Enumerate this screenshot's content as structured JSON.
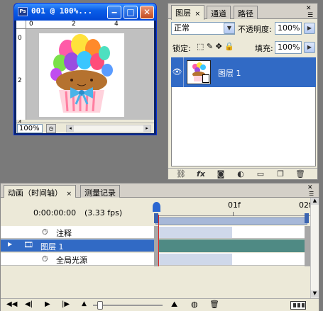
{
  "document": {
    "title": "001 @ 100%...",
    "app_badge": "Ps",
    "zoom": "100%",
    "ruler_top": [
      "0",
      "2",
      "4"
    ],
    "ruler_left": [
      "0",
      "2",
      "4"
    ]
  },
  "layers_panel": {
    "tabs": [
      "图层",
      "通道",
      "路径"
    ],
    "blend_mode": "正常",
    "opacity_label": "不透明度:",
    "opacity_value": "100%",
    "lock_label": "锁定:",
    "fill_label": "填充:",
    "fill_value": "100%",
    "layer_name": "图层 1"
  },
  "animation_panel": {
    "tabs": [
      "动画（时间轴）",
      "测量记录"
    ],
    "time": "0:00:00:00",
    "fps": "(3.33 fps)",
    "ruler_labels": [
      "01f",
      "02f"
    ],
    "tracks": [
      {
        "label": "注释"
      },
      {
        "label": "图层 1"
      },
      {
        "label": "全局光源"
      }
    ]
  },
  "colors": {
    "selection": "#316ac5",
    "titlebar": "#0a5ee8",
    "panel_bg": "#ece9d8"
  }
}
